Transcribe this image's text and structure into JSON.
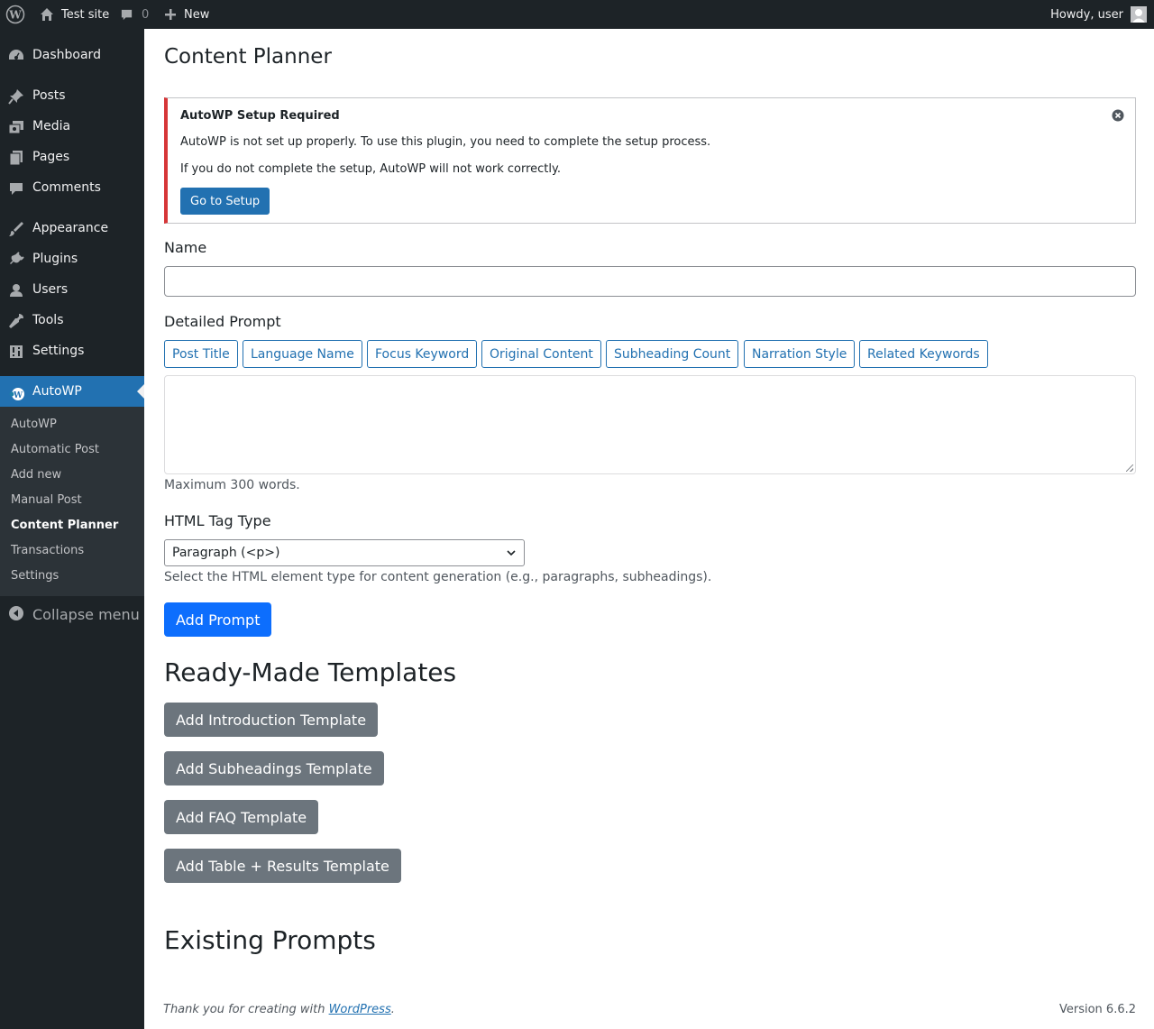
{
  "adminbar": {
    "site_name": "Test site",
    "comments_count": "0",
    "new_label": "New",
    "howdy": "Howdy, user"
  },
  "sidebar": {
    "items": [
      {
        "label": "Dashboard",
        "icon": "dashboard-icon"
      },
      {
        "label": "Posts",
        "icon": "pin-icon"
      },
      {
        "label": "Media",
        "icon": "media-icon"
      },
      {
        "label": "Pages",
        "icon": "pages-icon"
      },
      {
        "label": "Comments",
        "icon": "comment-icon"
      },
      {
        "label": "Appearance",
        "icon": "brush-icon"
      },
      {
        "label": "Plugins",
        "icon": "plug-icon"
      },
      {
        "label": "Users",
        "icon": "user-icon"
      },
      {
        "label": "Tools",
        "icon": "wrench-icon"
      },
      {
        "label": "Settings",
        "icon": "settings-icon"
      },
      {
        "label": "AutoWP",
        "icon": "wordpress-icon"
      }
    ],
    "submenu": [
      "AutoWP",
      "Automatic Post",
      "Add new",
      "Manual Post",
      "Content Planner",
      "Transactions",
      "Settings"
    ],
    "collapse_label": "Collapse menu"
  },
  "page": {
    "title": "Content Planner"
  },
  "notice": {
    "title": "AutoWP Setup Required",
    "p1": "AutoWP is not set up properly. To use this plugin, you need to complete the setup process.",
    "p2": "If you do not complete the setup, AutoWP will not work correctly.",
    "button": "Go to Setup"
  },
  "form": {
    "name_label": "Name",
    "name_value": "",
    "prompt_label": "Detailed Prompt",
    "tags": [
      "Post Title",
      "Language Name",
      "Focus Keyword",
      "Original Content",
      "Subheading Count",
      "Narration Style",
      "Related Keywords"
    ],
    "prompt_value": "",
    "prompt_hint": "Maximum 300 words.",
    "tag_type_label": "HTML Tag Type",
    "tag_type_value": "Paragraph (<p>)",
    "tag_type_hint": "Select the HTML element type for content generation (e.g., paragraphs, subheadings).",
    "add_button": "Add Prompt"
  },
  "templates": {
    "heading": "Ready-Made Templates",
    "buttons": [
      "Add Introduction Template",
      "Add Subheadings Template",
      "Add FAQ Template",
      "Add Table + Results Template"
    ]
  },
  "existing": {
    "heading": "Existing Prompts"
  },
  "footer": {
    "thanks": "Thank you for creating with ",
    "link": "WordPress",
    "dot": ".",
    "version": "Version 6.6.2"
  },
  "colors": {
    "adminbar_bg": "#1d2327",
    "accent": "#2271b1",
    "notice_border": "#d63638",
    "primary_button": "#0d6efd",
    "secondary_button": "#6c757d"
  }
}
